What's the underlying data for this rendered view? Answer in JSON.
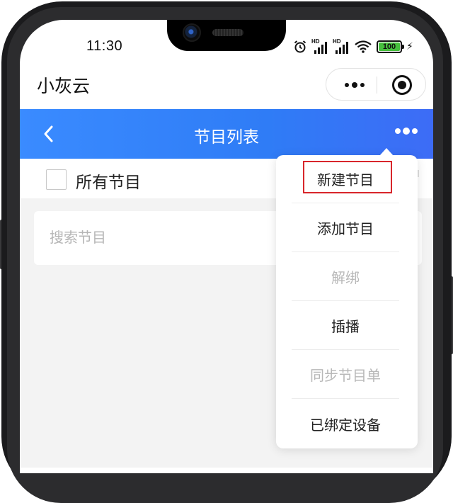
{
  "status_bar": {
    "time": "11:30",
    "signal1_label": "HD",
    "signal2_label": "HD",
    "battery": "100"
  },
  "mini_program": {
    "title": "小灰云"
  },
  "navbar": {
    "title": "节目列表"
  },
  "list_header": {
    "select_all_label": "所有节目"
  },
  "search": {
    "placeholder": "搜索节目"
  },
  "popup_menu": {
    "items": [
      {
        "label": "新建节目",
        "enabled": true
      },
      {
        "label": "添加节目",
        "enabled": true
      },
      {
        "label": "解绑",
        "enabled": false
      },
      {
        "label": "插播",
        "enabled": true
      },
      {
        "label": "同步节目单",
        "enabled": false
      },
      {
        "label": "已绑定设备",
        "enabled": true
      }
    ]
  },
  "colors": {
    "navbar_gradient_start": "#3a8bff",
    "navbar_gradient_end": "#3d6cf6",
    "highlight": "#d8262b",
    "battery_fill": "#46c03e",
    "disabled_text": "#b8b8b8"
  }
}
